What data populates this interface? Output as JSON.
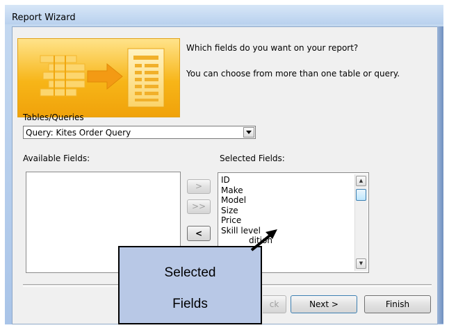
{
  "window": {
    "title": "Report Wizard"
  },
  "intro": {
    "question": "Which fields do you want on your report?",
    "hint": "You can choose from more than one table or query."
  },
  "tables_queries": {
    "label": "Tables/Queries",
    "selected": "Query: Kites Order Query"
  },
  "available_fields": {
    "label": "Available Fields:",
    "items": []
  },
  "selected_fields": {
    "label": "Selected Fields:",
    "items": [
      "ID",
      "Make",
      "Model",
      "Size",
      "Price",
      "Skill level",
      "dition"
    ]
  },
  "move_buttons": {
    "add_one": ">",
    "add_all": ">>",
    "remove_one": "<"
  },
  "footer": {
    "back": "ck",
    "next": "Next >",
    "finish": "Finish"
  },
  "callout": {
    "line1": "Selected",
    "line2": "Fields"
  },
  "colors": {
    "banner": "#f7b518",
    "callout_fill": "#b8c8e6",
    "title_bar": "#c5d9f1"
  }
}
